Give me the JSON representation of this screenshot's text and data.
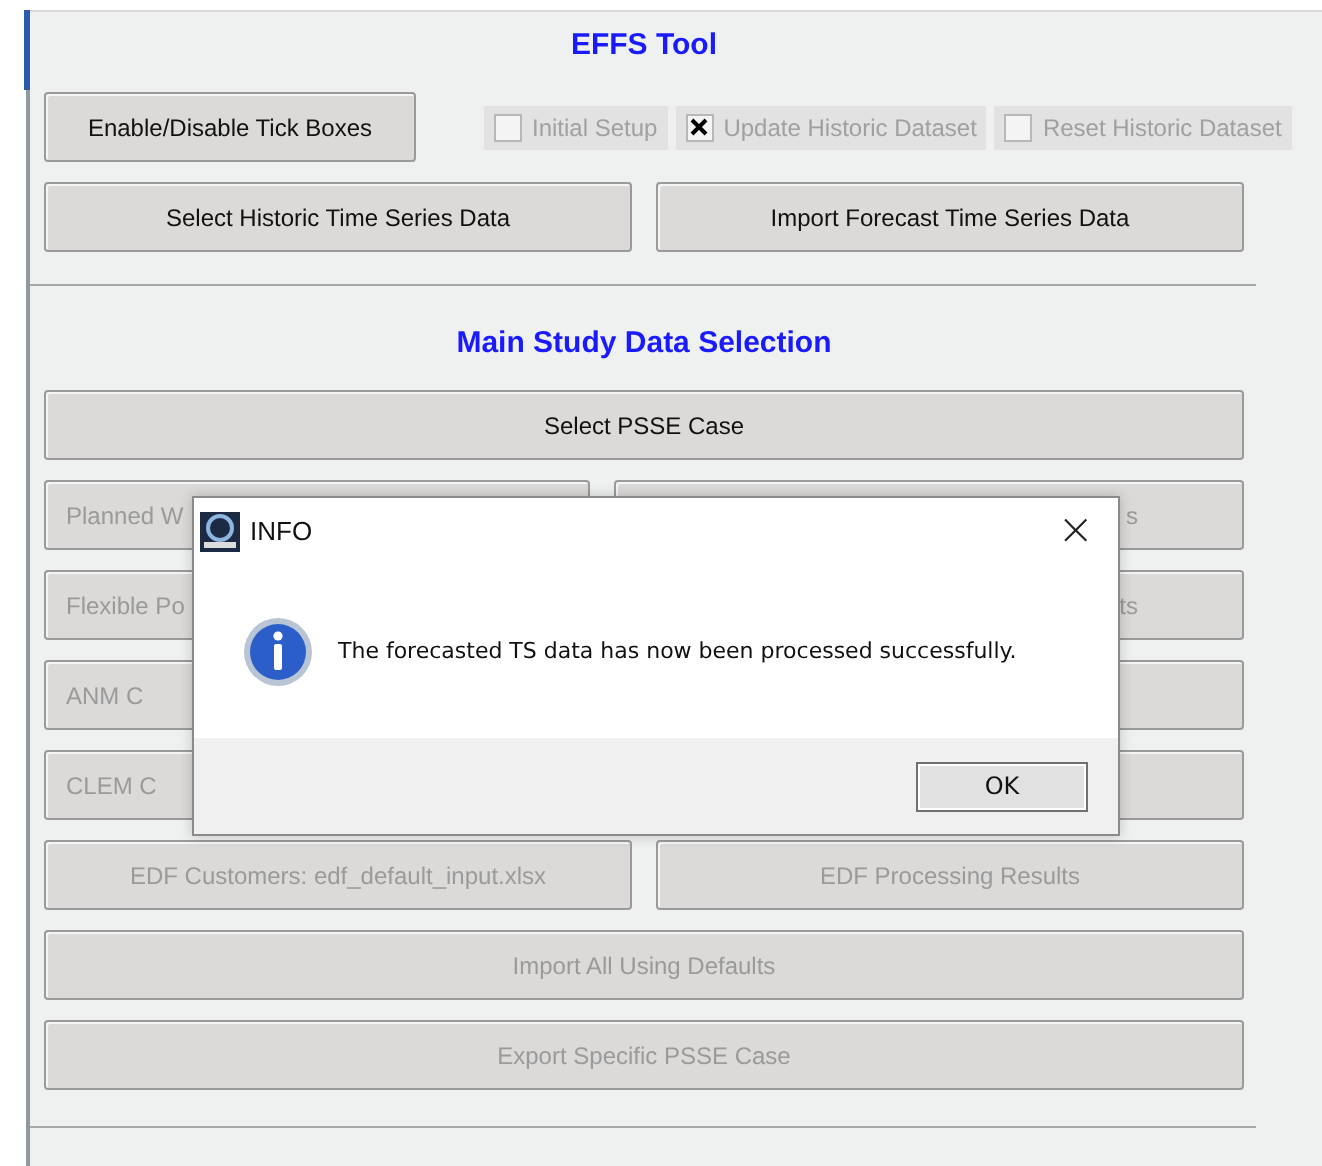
{
  "title": "EFFS Tool",
  "toggle_button": {
    "label": "Enable/Disable Tick Boxes",
    "disabled": false
  },
  "checkboxes": [
    {
      "label": "Initial Setup",
      "checked": false,
      "disabled": true
    },
    {
      "label": "Update Historic Dataset",
      "checked": true,
      "disabled": true
    },
    {
      "label": "Reset Historic Dataset",
      "checked": false,
      "disabled": true
    }
  ],
  "top_buttons": [
    {
      "label": "Select Historic Time Series Data",
      "disabled": false
    },
    {
      "label": "Import Forecast Time Series Data",
      "disabled": false
    }
  ],
  "section_title": "Main Study Data Selection",
  "rows": [
    [
      {
        "kind": "full",
        "label": "Select PSSE Case",
        "disabled": false
      }
    ],
    [
      {
        "kind": "clip_end",
        "label": "Planned W",
        "disabled": true
      },
      {
        "kind": "clip_start",
        "label": "s",
        "disabled": true
      }
    ],
    [
      {
        "kind": "clip_end",
        "label": "Flexible Po",
        "disabled": true
      },
      {
        "kind": "clip_start",
        "label": "ts",
        "disabled": true
      }
    ],
    [
      {
        "kind": "clip_end",
        "label": "ANM C",
        "disabled": true
      },
      {
        "kind": "blank"
      }
    ],
    [
      {
        "kind": "clip_end",
        "label": "CLEM C",
        "disabled": true
      },
      {
        "kind": "blank"
      }
    ],
    [
      {
        "kind": "full",
        "label": "EDF Customers: edf_default_input.xlsx",
        "disabled": true
      },
      {
        "kind": "full",
        "label": "EDF Processing Results",
        "disabled": true
      }
    ],
    [
      {
        "kind": "full",
        "label": "Import All Using Defaults",
        "disabled": true
      }
    ],
    [
      {
        "kind": "full",
        "label": "Export Specific PSSE Case",
        "disabled": true
      }
    ]
  ],
  "dialog": {
    "title": "INFO",
    "close": "×",
    "message": "The forecasted TS data has now been processed successfully.",
    "button": "OK"
  }
}
